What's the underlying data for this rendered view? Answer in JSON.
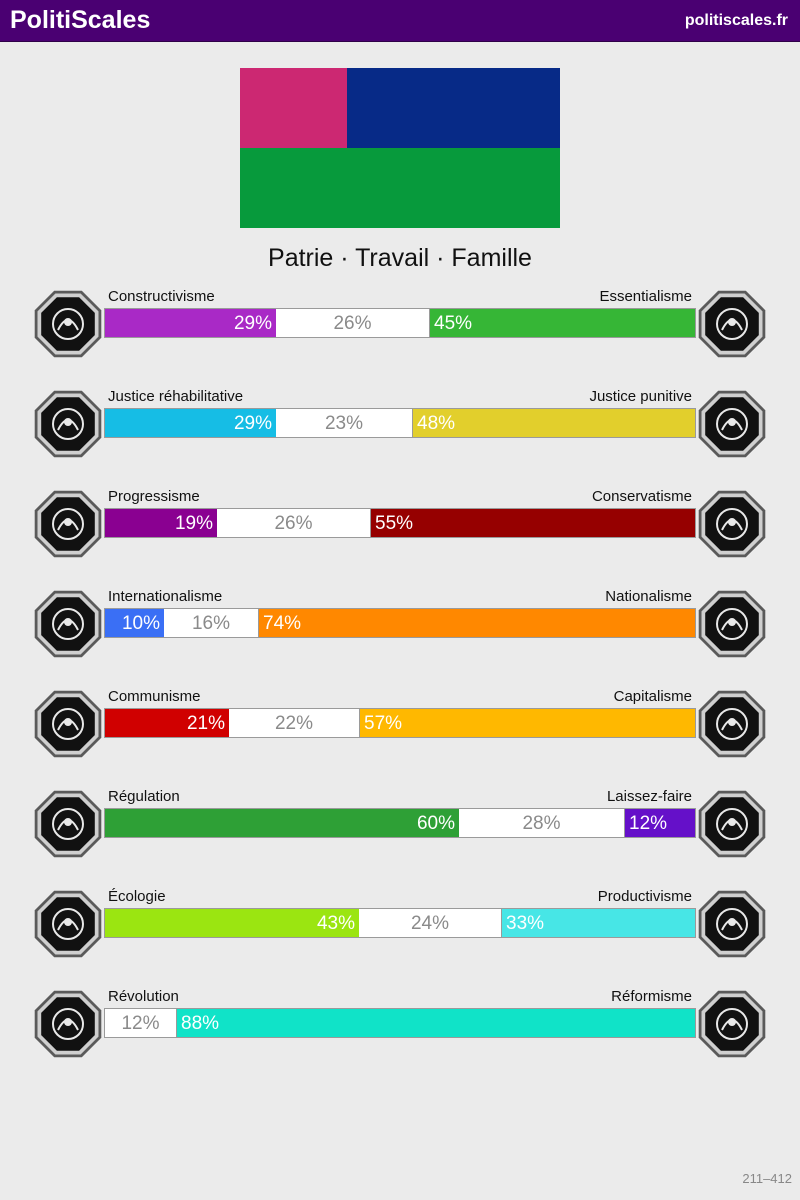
{
  "header": {
    "brand": "PolitiScales",
    "site": "politiscales.fr",
    "background": "#4a0072"
  },
  "flag": {
    "colors": [
      "#cc2872",
      "#072a87",
      "#079a3c"
    ]
  },
  "slogan": "Patrie · Travail · Famille",
  "axes": [
    {
      "id": "constructivism",
      "left_label": "Constructivisme",
      "right_label": "Essentialisme",
      "left_pct": 29,
      "mid_pct": 26,
      "right_pct": 45,
      "left_text": "29%",
      "mid_text": "26%",
      "right_text": "45%",
      "left_color": "#a929c6",
      "right_color": "#36b636",
      "left_icon": "eye-icon",
      "right_icon": "dna-flower-icon"
    },
    {
      "id": "justice",
      "left_label": "Justice réhabilitative",
      "right_label": "Justice punitive",
      "left_pct": 29,
      "mid_pct": 23,
      "right_pct": 48,
      "left_text": "29%",
      "mid_text": "23%",
      "right_text": "48%",
      "left_color": "#16bde5",
      "right_color": "#e2cf2c",
      "left_icon": "handshake-icon",
      "right_icon": "prison-bars-icon"
    },
    {
      "id": "progress",
      "left_label": "Progressisme",
      "right_label": "Conservatisme",
      "left_pct": 19,
      "mid_pct": 26,
      "right_pct": 55,
      "left_text": "19%",
      "mid_text": "26%",
      "right_text": "55%",
      "left_color": "#8a0091",
      "right_color": "#960000",
      "left_icon": "rocket-icon",
      "right_icon": "quill-icon"
    },
    {
      "id": "nation",
      "left_label": "Internationalisme",
      "right_label": "Nationalisme",
      "left_pct": 10,
      "mid_pct": 16,
      "right_pct": 74,
      "left_text": "10%",
      "mid_text": "16%",
      "right_text": "74%",
      "left_color": "#3a6ff5",
      "right_color": "#ff8800",
      "left_icon": "globe-icon",
      "right_icon": "flag-icon"
    },
    {
      "id": "economy",
      "left_label": "Communisme",
      "right_label": "Capitalisme",
      "left_pct": 21,
      "mid_pct": 22,
      "right_pct": 57,
      "left_text": "21%",
      "mid_text": "22%",
      "right_text": "57%",
      "left_color": "#d00000",
      "right_color": "#ffb800",
      "left_icon": "hammer-sickle-icon",
      "right_icon": "money-bag-icon"
    },
    {
      "id": "market",
      "left_label": "Régulation",
      "right_label": "Laissez-faire",
      "left_pct": 60,
      "mid_pct": 28,
      "right_pct": 12,
      "left_text": "60%",
      "mid_text": "28%",
      "right_text": "12%",
      "left_color": "#2ea036",
      "right_color": "#6510c9",
      "left_icon": "ruler-icon",
      "right_icon": "butterfly-icon"
    },
    {
      "id": "ecology",
      "left_label": "Écologie",
      "right_label": "Productivisme",
      "left_pct": 43,
      "mid_pct": 24,
      "right_pct": 33,
      "left_text": "43%",
      "mid_text": "24%",
      "right_text": "33%",
      "left_color": "#9be511",
      "right_color": "#47e6e6",
      "left_icon": "sprout-icon",
      "right_icon": "gear-icon"
    },
    {
      "id": "method",
      "left_label": "Révolution",
      "right_label": "Réformisme",
      "left_pct": 0,
      "mid_pct": 12,
      "right_pct": 88,
      "left_text": "",
      "mid_text": "12%",
      "right_text": "88%",
      "left_color": "#c0392b",
      "right_color": "#10e3c8",
      "left_icon": "fist-icon",
      "right_icon": "parliament-icon"
    }
  ],
  "footer": "211–412"
}
